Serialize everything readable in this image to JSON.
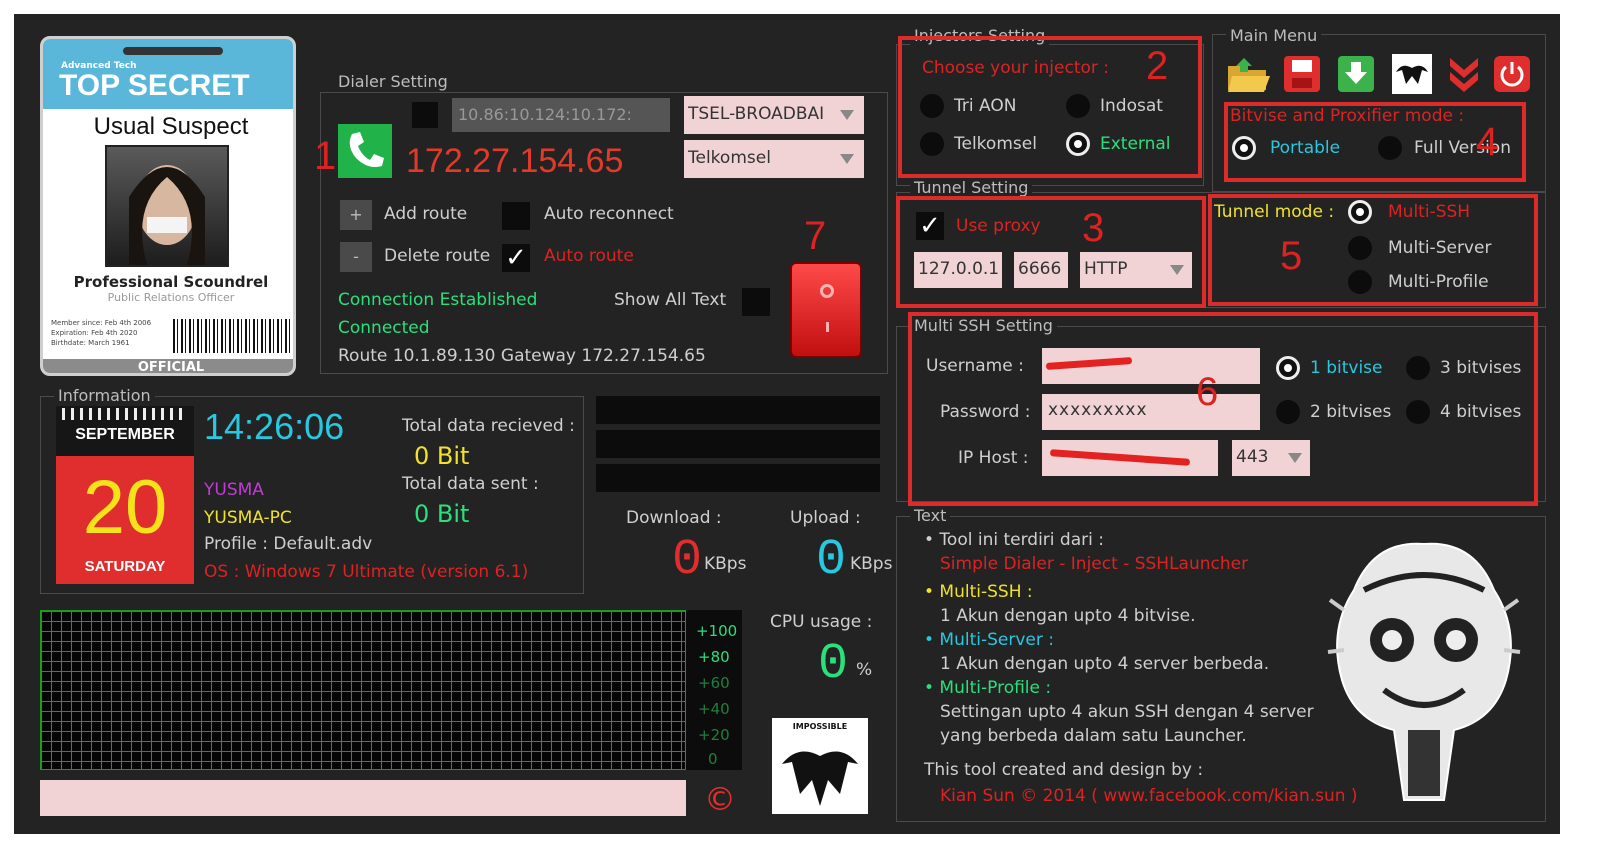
{
  "id_card": {
    "small": "Advanced Tech",
    "top_secret": "TOP SECRET",
    "title": "Usual Suspect",
    "role": "Professional Scoundrel",
    "sub": "Public Relations Officer",
    "member": "Member since: Feb 4th 2006",
    "expire": "Expiration: Feb 4th 2020",
    "birth": "Birthdate: March 1961",
    "official": "OFFICIAL"
  },
  "dialer": {
    "group_title": "Dialer Setting",
    "ip_field": "10.86:10.124:10.172:",
    "apn_select": "TSEL-BROADBAI",
    "operator_select": "Telkomsel",
    "ip_address": "172.27.154.65",
    "add_route": "Add route",
    "delete_route": "Delete route",
    "auto_reconnect": "Auto reconnect",
    "auto_route": "Auto route",
    "status1": "Connection Established",
    "status2": "Connected",
    "show_all_text": "Show All Text",
    "route_info": "Route 10.1.89.130 Gateway 172.27.154.65"
  },
  "injectors": {
    "group_title": "Injectors Setting",
    "prompt": "Choose your injector :",
    "options": [
      "Tri AON",
      "Indosat",
      "Telkomsel",
      "External"
    ]
  },
  "main_menu": {
    "group_title": "Main Menu",
    "icons": [
      "folder-open-icon",
      "save-icon",
      "download-icon",
      "logo-icon",
      "chevron-down-icon",
      "power-icon"
    ]
  },
  "bitvise": {
    "title": "Bitvise and Proxifier mode :",
    "portable": "Portable",
    "full": "Full Version"
  },
  "tunnel": {
    "group_title": "Tunnel Setting",
    "use_proxy": "Use proxy",
    "proxy_ip": "127.0.0.1",
    "proxy_port": "6666",
    "proxy_type": "HTTP",
    "mode_label": "Tunnel mode :",
    "modes": [
      "Multi-SSH",
      "Multi-Server",
      "Multi-Profile"
    ]
  },
  "multi_ssh": {
    "group_title": "Multi SSH Setting",
    "username_label": "Username :",
    "password_label": "Password :",
    "ip_host_label": "IP Host :",
    "password_value": "xxxxxxxxx",
    "port": "443",
    "bitvise_options": [
      "1 bitvise",
      "3 bitvises",
      "2 bitvises",
      "4 bitvises"
    ]
  },
  "information": {
    "group_title": "Information",
    "month": "SEPTEMBER",
    "day": "20",
    "weekday": "SATURDAY",
    "time": "14:26:06",
    "user": "YUSMA",
    "pc": "YUSMA-PC",
    "profile": "Profile : Default.adv",
    "os": "OS : Windows 7 Ultimate (version 6.1)",
    "received_label": "Total data recieved :",
    "received": "0 Bit",
    "sent_label": "Total data sent :",
    "sent": "0 Bit"
  },
  "stats": {
    "download_label": "Download :",
    "upload_label": "Upload :",
    "download_value": "0",
    "upload_value": "0",
    "unit": "KBps",
    "cpu_label": "CPU usage :",
    "cpu_value": "0",
    "cpu_unit": "%",
    "scale": [
      "+100",
      "+80",
      "+60",
      "+40",
      "+20",
      "0"
    ],
    "copyright_symbol": "©",
    "logo_text": "IMPOSSIBLE"
  },
  "text_panel": {
    "group_title": "Text",
    "l1": "• Tool ini terdiri dari :",
    "l2": "Simple Dialer - Inject - SSHLauncher",
    "l3": "• Multi-SSH :",
    "l4": "1 Akun dengan upto 4 bitvise.",
    "l5": "• Multi-Server :",
    "l6": "1 Akun dengan upto 4 server berbeda.",
    "l7": "• Multi-Profile :",
    "l8": "Settingan upto 4 akun SSH dengan 4 server",
    "l9": "yang berbeda dalam satu Launcher.",
    "l10": "This tool created and design by :",
    "l11": "Kian Sun   © 2014  ( www.facebook.com/kian.sun )"
  },
  "annotations": [
    "1",
    "2",
    "3",
    "4",
    "5",
    "6",
    "7"
  ],
  "colors": {
    "accent_red": "#dd2222",
    "cyan": "#27c8e0",
    "green": "#29e07a",
    "yellow": "#f2e12a",
    "magenta": "#c23bd6"
  }
}
